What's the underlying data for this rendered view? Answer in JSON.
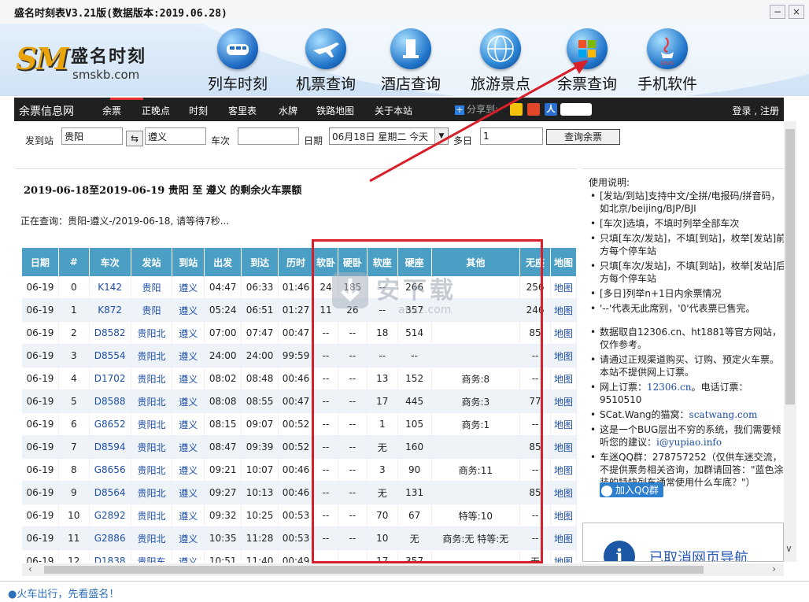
{
  "window": {
    "title": "盛名时刻表V3.21版(数据版本:2019.06.28)",
    "minimize": "−",
    "close": "×"
  },
  "logo": {
    "mark": "SM",
    "name": "盛名时刻",
    "url": "smskb.com"
  },
  "nav": [
    {
      "label": "列车时刻",
      "icon": "train-icon"
    },
    {
      "label": "机票查询",
      "icon": "airplane-icon"
    },
    {
      "label": "酒店查询",
      "icon": "hotel-icon"
    },
    {
      "label": "旅游景点",
      "icon": "globe-icon"
    },
    {
      "label": "余票查询",
      "icon": "windows-icon"
    },
    {
      "label": "手机软件",
      "icon": "java-icon"
    }
  ],
  "menubar": {
    "brand": "余票信息网",
    "items": [
      "余票",
      "正晚点",
      "时刻",
      "客里表",
      "水牌",
      "铁路地图",
      "关于本站"
    ],
    "share": "分享到:",
    "user": "人",
    "login": "登录",
    "register": "注册"
  },
  "search": {
    "from_label": "发到站",
    "from": "贵阳",
    "to": "遵义",
    "train_label": "车次",
    "train": "",
    "date_label": "日期",
    "date": "06月18日 星期二 今天",
    "days_label": "多日",
    "days": "1",
    "submit": "查询余票"
  },
  "result": {
    "title": "2019-06-18至2019-06-19 贵阳  至  遵义  的剩余火车票额",
    "status": "正在查询：贵阳-遵义-/2019-06-18, 请等待7秒..."
  },
  "table": {
    "headers": [
      "日期",
      "#",
      "车次",
      "发站",
      "到站",
      "出发",
      "到达",
      "历时",
      "软卧",
      "硬卧",
      "软座",
      "硬座",
      "其他",
      "无座",
      "地图"
    ],
    "rows": [
      [
        "06-19",
        "0",
        "K142",
        "贵阳",
        "遵义",
        "04:47",
        "06:33",
        "01:46",
        "24",
        "185",
        "--",
        "266",
        "",
        "256",
        "地图"
      ],
      [
        "06-19",
        "1",
        "K872",
        "贵阳",
        "遵义",
        "05:24",
        "06:51",
        "01:27",
        "11",
        "26",
        "--",
        "357",
        "",
        "246",
        "地图"
      ],
      [
        "06-19",
        "2",
        "D8582",
        "贵阳北",
        "遵义",
        "07:00",
        "07:47",
        "00:47",
        "--",
        "--",
        "18",
        "514",
        "",
        "85",
        "地图"
      ],
      [
        "06-19",
        "3",
        "D8554",
        "贵阳北",
        "遵义",
        "24:00",
        "24:00",
        "99:59",
        "--",
        "--",
        "--",
        "--",
        "",
        "--",
        "地图"
      ],
      [
        "06-19",
        "4",
        "D1702",
        "贵阳北",
        "遵义",
        "08:02",
        "08:48",
        "00:46",
        "--",
        "--",
        "13",
        "152",
        "商务:8",
        "--",
        "地图"
      ],
      [
        "06-19",
        "5",
        "D8588",
        "贵阳北",
        "遵义",
        "08:08",
        "08:55",
        "00:47",
        "--",
        "--",
        "17",
        "445",
        "商务:3",
        "77",
        "地图"
      ],
      [
        "06-19",
        "6",
        "G8652",
        "贵阳北",
        "遵义",
        "08:15",
        "09:07",
        "00:52",
        "--",
        "--",
        "1",
        "105",
        "商务:1",
        "--",
        "地图"
      ],
      [
        "06-19",
        "7",
        "D8594",
        "贵阳北",
        "遵义",
        "08:47",
        "09:39",
        "00:52",
        "--",
        "--",
        "无",
        "160",
        "",
        "85",
        "地图"
      ],
      [
        "06-19",
        "8",
        "G8656",
        "贵阳北",
        "遵义",
        "09:21",
        "10:07",
        "00:46",
        "--",
        "--",
        "3",
        "90",
        "商务:11",
        "--",
        "地图"
      ],
      [
        "06-19",
        "9",
        "D8564",
        "贵阳北",
        "遵义",
        "09:27",
        "10:13",
        "00:46",
        "--",
        "--",
        "无",
        "131",
        "",
        "85",
        "地图"
      ],
      [
        "06-19",
        "10",
        "G2892",
        "贵阳北",
        "遵义",
        "09:32",
        "10:25",
        "00:53",
        "--",
        "--",
        "70",
        "67",
        "特等:10",
        "--",
        "地图"
      ],
      [
        "06-19",
        "11",
        "G2886",
        "贵阳北",
        "遵义",
        "10:35",
        "11:28",
        "00:53",
        "--",
        "--",
        "10",
        "无",
        "商务:无 特等:无",
        "--",
        "地图"
      ],
      [
        "06-19",
        "12",
        "D1838",
        "贵阳东",
        "遵义",
        "10:51",
        "11:40",
        "00:49",
        "--",
        "--",
        "17",
        "357",
        "",
        "无",
        "地图"
      ]
    ]
  },
  "watermark": {
    "line1": "安下载",
    "line2": "anxz.com"
  },
  "help": {
    "title": "使用说明:",
    "items": [
      "[发站/到站]支持中文/全拼/电报码/拼音码，如北京/beijing/BJP/BJI",
      "[车次]选填，不填时列举全部车次",
      "只填[车次/发站]，不填[到站]，枚举[发站]前方每个停车站",
      "只填[车次/发站]，不填[到站]，枚举[发站]后方每个停车站",
      "[多日]列举n+1日内余票情况",
      "'--'代表无此席别，'0'代表票已售完。"
    ],
    "items2": [
      "数据取自12306.cn、ht1881等官方网站，仅作参考。",
      "请通过正规渠道购买、订购、预定火车票。本站不提供网上订票。"
    ],
    "ticket_prefix": "网上订票：",
    "ticket_site": "12306.cn",
    "ticket_phone": "。电话订票：9510510",
    "scat_prefix": "SCat.Wang的猫窝：",
    "scat_site": "scatwang.com",
    "bug_text": "这是一个BUG层出不穷的系统，我们需要倾听您的建议：",
    "bug_email": "i@yupiao.info",
    "qq_text": "车迷QQ群：278757252（仅供车迷交流，不提供票务相关咨询，加群请回答：\"蓝色涂装的特快列车通常使用什么车底？\"）",
    "qq_button": "加入QQ群"
  },
  "cancelled_nav": "已取消网页导航",
  "status_text": "●火车出行，先看盛名！",
  "colors": {
    "menubar": "#1e2022",
    "table_header": "#4b9fc4",
    "link_blue": "#1d4fa8",
    "annotation_red": "#d8202a"
  }
}
